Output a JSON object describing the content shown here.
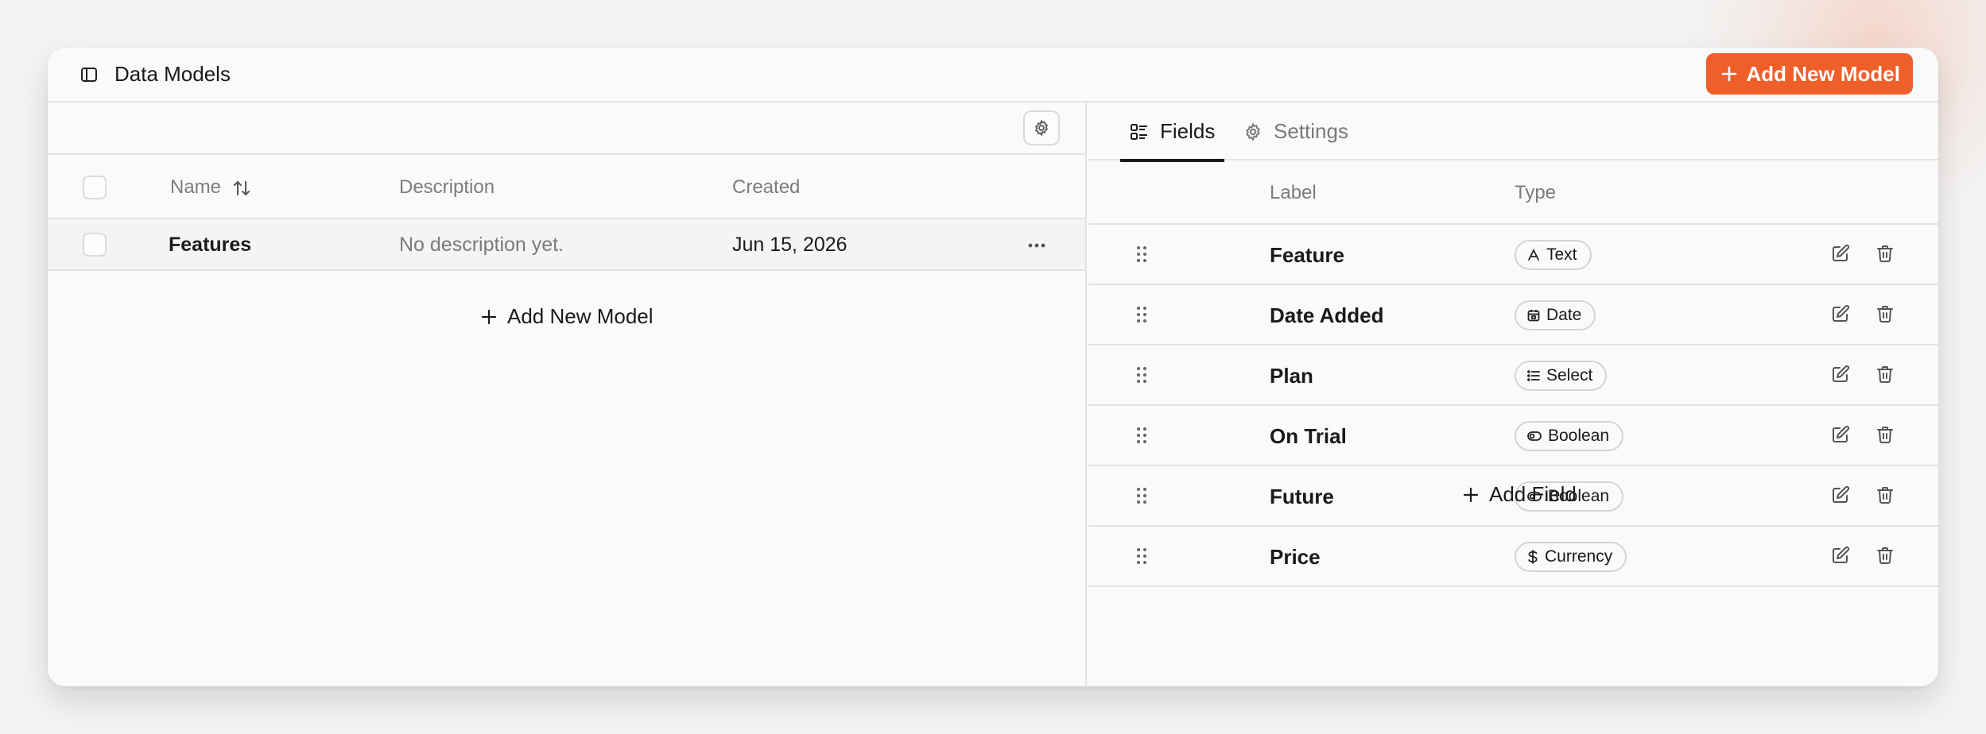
{
  "header": {
    "title": "Data Models",
    "add_button_label": "Add New Model",
    "accent_color": "#ee5f2a"
  },
  "models_table": {
    "columns": [
      "Name",
      "Description",
      "Created"
    ],
    "rows": [
      {
        "name": "Features",
        "description": "No description yet.",
        "created": "Jun 15, 2026"
      }
    ],
    "add_label": "Add New Model"
  },
  "tabs": [
    {
      "label": "Fields",
      "icon": "list-fields-icon",
      "active": true
    },
    {
      "label": "Settings",
      "icon": "gear-icon",
      "active": false
    }
  ],
  "fields_table": {
    "columns": [
      "Label",
      "Type"
    ],
    "rows": [
      {
        "label": "Feature",
        "type": "Text",
        "icon": "text-type-icon"
      },
      {
        "label": "Date Added",
        "type": "Date",
        "icon": "calendar-icon"
      },
      {
        "label": "Plan",
        "type": "Select",
        "icon": "list-icon"
      },
      {
        "label": "On Trial",
        "type": "Boolean",
        "icon": "toggle-icon"
      },
      {
        "label": "Future",
        "type": "Boolean",
        "icon": "toggle-icon"
      },
      {
        "label": "Price",
        "type": "Currency",
        "icon": "dollar-icon"
      }
    ],
    "add_label": "Add Field"
  }
}
